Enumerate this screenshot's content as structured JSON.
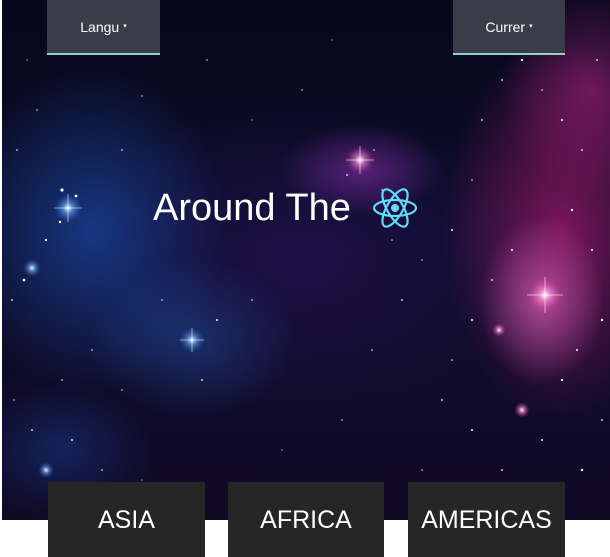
{
  "header": {
    "language_label": "Langu",
    "currency_label": "Currer",
    "caret": "▾"
  },
  "hero": {
    "title": "Around The",
    "logo_icon": "react-atom-icon",
    "colors": {
      "logo": "#61dafb",
      "space_dark": "#07081a",
      "nebula_pink": "#d21e82",
      "nebula_blue": "#1e5ac8"
    }
  },
  "regions": [
    {
      "label": "ASIA"
    },
    {
      "label": "AFRICA"
    },
    {
      "label": "AMERICAS"
    }
  ],
  "colors": {
    "dropdown_bg": "#3b3c4a",
    "dropdown_underline": "#8fd3c7",
    "button_bg": "#262626",
    "text": "#ffffff"
  }
}
